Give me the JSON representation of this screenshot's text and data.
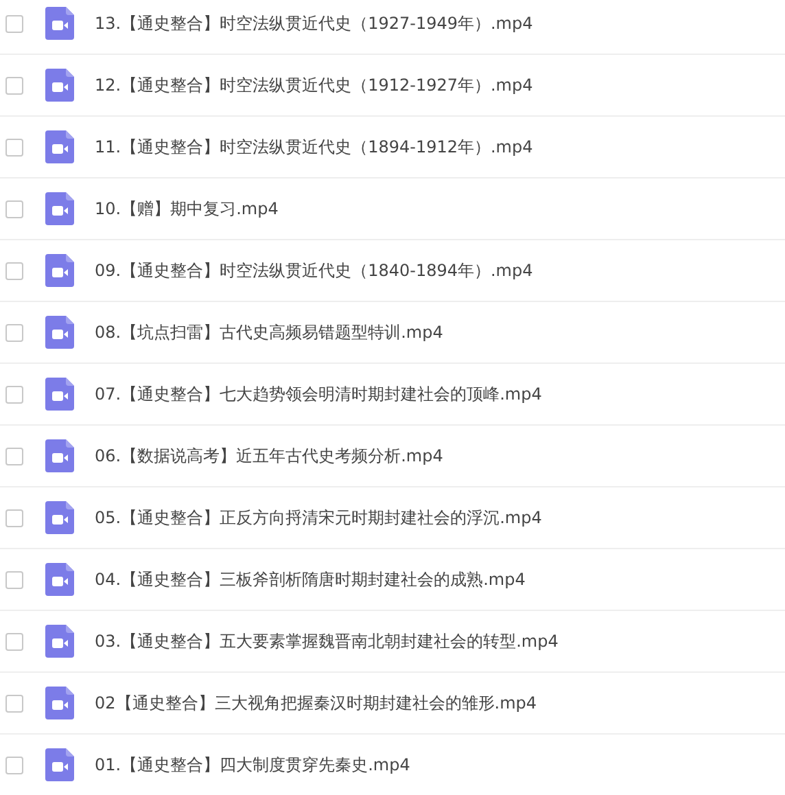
{
  "files": [
    {
      "name": "13.【通史整合】时空法纵贯近代史（1927-1949年）.mp4",
      "checked": false
    },
    {
      "name": "12.【通史整合】时空法纵贯近代史（1912-1927年）.mp4",
      "checked": false
    },
    {
      "name": "11.【通史整合】时空法纵贯近代史（1894-1912年）.mp4",
      "checked": false
    },
    {
      "name": "10.【赠】期中复习.mp4",
      "checked": false
    },
    {
      "name": "09.【通史整合】时空法纵贯近代史（1840-1894年）.mp4",
      "checked": false
    },
    {
      "name": "08.【坑点扫雷】古代史高频易错题型特训.mp4",
      "checked": false
    },
    {
      "name": "07.【通史整合】七大趋势领会明清时期封建社会的顶峰.mp4",
      "checked": false
    },
    {
      "name": "06.【数据说高考】近五年古代史考频分析.mp4",
      "checked": false
    },
    {
      "name": "05.【通史整合】正反方向捋清宋元时期封建社会的浮沉.mp4",
      "checked": false
    },
    {
      "name": "04.【通史整合】三板斧剖析隋唐时期封建社会的成熟.mp4",
      "checked": false
    },
    {
      "name": "03.【通史整合】五大要素掌握魏晋南北朝封建社会的转型.mp4",
      "checked": false
    },
    {
      "name": "02【通史整合】三大视角把握秦汉时期封建社会的雏形.mp4",
      "checked": false
    },
    {
      "name": "01.【通史整合】四大制度贯穿先秦史.mp4",
      "checked": false
    }
  ]
}
